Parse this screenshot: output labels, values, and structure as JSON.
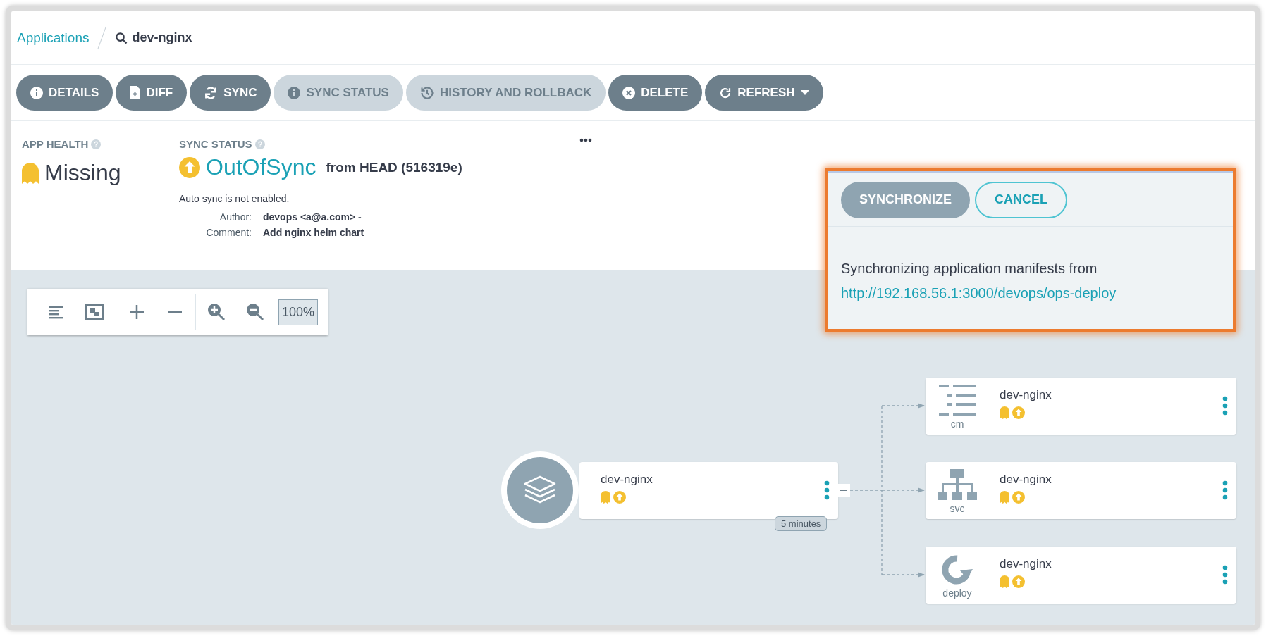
{
  "breadcrumb": {
    "link": "Applications",
    "current": "dev-nginx"
  },
  "toolbar": [
    {
      "label": "DETAILS",
      "disabled": false,
      "dropdown": false
    },
    {
      "label": "DIFF",
      "disabled": false,
      "dropdown": false
    },
    {
      "label": "SYNC",
      "disabled": false,
      "dropdown": false
    },
    {
      "label": "SYNC STATUS",
      "disabled": true,
      "dropdown": false
    },
    {
      "label": "HISTORY AND ROLLBACK",
      "disabled": true,
      "dropdown": false
    },
    {
      "label": "DELETE",
      "disabled": false,
      "dropdown": false
    },
    {
      "label": "REFRESH",
      "disabled": false,
      "dropdown": true
    }
  ],
  "app_health": {
    "title": "APP HEALTH",
    "status": "Missing"
  },
  "sync_status": {
    "title": "SYNC STATUS",
    "status": "OutOfSync",
    "revision": "from HEAD (516319e)",
    "note": "Auto sync is not enabled.",
    "details": [
      {
        "label": "Author:",
        "value": "devops <a@a.com> -"
      },
      {
        "label": "Comment:",
        "value": "Add nginx helm chart"
      }
    ]
  },
  "graph_toolbar": {
    "zoom": "100%"
  },
  "sync_panel": {
    "buttons": [
      {
        "label": "SYNCHRONIZE",
        "kind": "primary"
      },
      {
        "label": "CANCEL",
        "kind": "outline"
      }
    ],
    "message": "Synchronizing application manifests from",
    "repo_url": "http://192.168.56.1:3000/devops/ops-deploy"
  },
  "graph": {
    "app": {
      "name": "dev-nginx",
      "age": "5 minutes"
    },
    "resources": [
      {
        "name": "dev-nginx",
        "kind": "cm"
      },
      {
        "name": "dev-nginx",
        "kind": "svc"
      },
      {
        "name": "dev-nginx",
        "kind": "deploy"
      }
    ]
  }
}
